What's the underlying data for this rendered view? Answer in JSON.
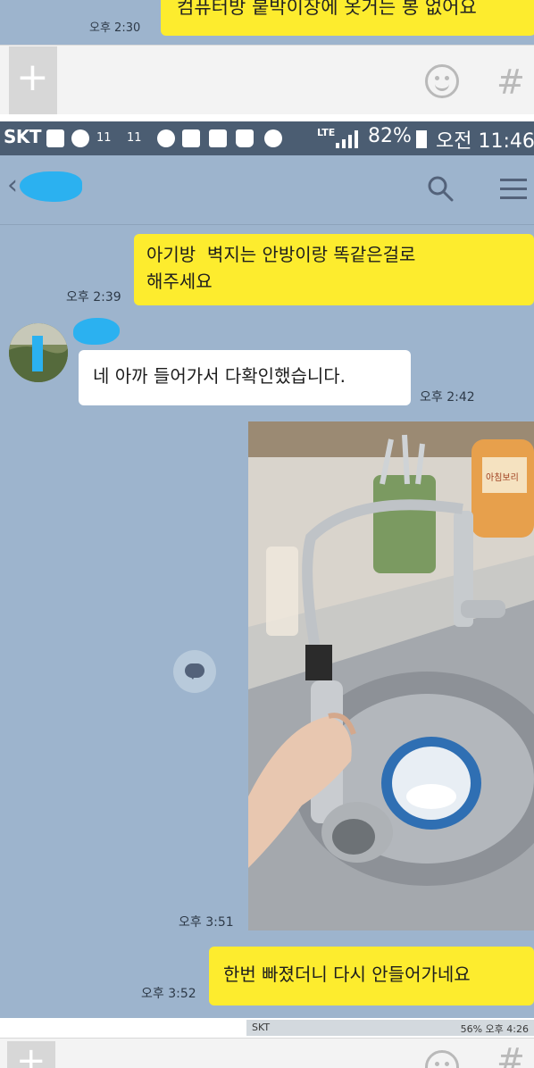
{
  "previous_screenshot": {
    "last_message": {
      "time": "오후 2:30",
      "text": "컴퓨터방 붙박이장에 옷거는 봉 없어요"
    },
    "input_bar": {
      "plus_icon": "plus-icon",
      "emoji_icon": "emoji-icon",
      "hash_icon": "hash-icon",
      "hash_glyph": "#",
      "plus_glyph": "+"
    }
  },
  "status_bar": {
    "carrier": "SKT",
    "notification_labels": [
      "11",
      "11"
    ],
    "network": "LTE",
    "battery": "82%",
    "clock": "오전 11:46"
  },
  "chat_header": {
    "back_icon": "back-icon",
    "search_icon": "search-icon",
    "menu_icon": "menu-icon",
    "back_glyph": "‹"
  },
  "messages": [
    {
      "side": "me",
      "lines": [
        "아기방  벽지는 안방이랑 똑같은걸로",
        "해주세요"
      ],
      "time": "오후 2:39"
    },
    {
      "side": "other",
      "text": "네 아까 들어가서 다확인했습니다.",
      "time": "오후 2:42"
    },
    {
      "side": "other",
      "type": "photo",
      "time": "오후 3:51"
    },
    {
      "side": "me",
      "text": "한번 빠졌더니 다시 안들어가네요",
      "time": "오후 3:52"
    }
  ],
  "photo_label": "아침보리",
  "next_screenshot_status": {
    "left": "SKT",
    "right": "56% 오후 4:26"
  },
  "colors": {
    "chat_bg": "#9db4cd",
    "my_bubble": "#fdec2e",
    "other_bubble": "#ffffff",
    "status_bar": "#4b5d72",
    "name_cover": "#2bb1f0"
  }
}
